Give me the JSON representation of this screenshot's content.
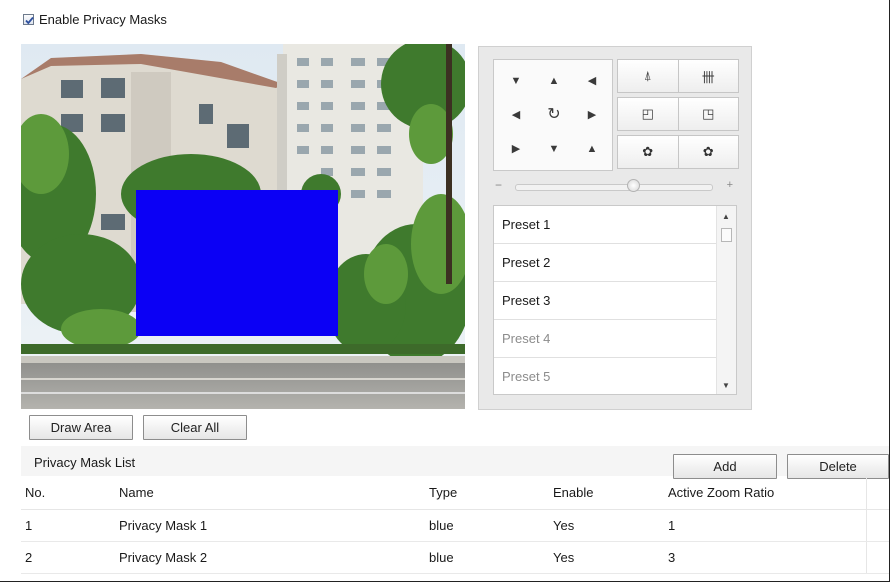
{
  "enable_privacy": {
    "label": "Enable Privacy Masks",
    "checked": true
  },
  "preview": {
    "mask_color": "#0b00f5"
  },
  "ptz": {
    "direction_buttons": [
      {
        "name": "up-left-button",
        "icon": "triangle-down-left-icon",
        "glyph": "▼"
      },
      {
        "name": "up-button",
        "icon": "triangle-up-icon",
        "glyph": "▲"
      },
      {
        "name": "up-right-button",
        "icon": "triangle-down-right-icon",
        "glyph": "◀"
      },
      {
        "name": "left-button",
        "icon": "triangle-left-icon",
        "glyph": "◀"
      },
      {
        "name": "auto-scan-button",
        "icon": "refresh-icon",
        "glyph": "↻"
      },
      {
        "name": "right-button",
        "icon": "triangle-right-icon",
        "glyph": "▶"
      },
      {
        "name": "down-left-button",
        "icon": "triangle-right-icon",
        "glyph": "▶"
      },
      {
        "name": "down-button",
        "icon": "triangle-down-icon",
        "glyph": "▼"
      },
      {
        "name": "down-right-button",
        "icon": "triangle-up-icon",
        "glyph": "▲"
      }
    ],
    "side_buttons": [
      {
        "left_icon": "zoom-in-tree-icon",
        "right_icon": "zoom-out-trees-icon"
      },
      {
        "left_icon": "focus-near-icon",
        "right_icon": "focus-far-icon"
      },
      {
        "left_icon": "iris-open-icon",
        "right_icon": "iris-close-icon"
      }
    ],
    "speed": {
      "minus": "−",
      "plus": "+",
      "level": 0.6
    },
    "presets": [
      {
        "label": "Preset 1",
        "dim": false
      },
      {
        "label": "Preset 2",
        "dim": false
      },
      {
        "label": "Preset 3",
        "dim": false
      },
      {
        "label": "Preset 4",
        "dim": true
      },
      {
        "label": "Preset 5",
        "dim": true
      }
    ]
  },
  "actions": {
    "draw_area": "Draw Area",
    "clear_all": "Clear All",
    "add": "Add",
    "delete": "Delete"
  },
  "mask_list": {
    "title": "Privacy Mask List",
    "columns": [
      "No.",
      "Name",
      "Type",
      "Enable",
      "Active Zoom Ratio",
      ""
    ],
    "rows": [
      [
        "1",
        "Privacy Mask 1",
        "blue",
        "Yes",
        "1",
        ""
      ],
      [
        "2",
        "Privacy Mask 2",
        "blue",
        "Yes",
        "3",
        ""
      ]
    ]
  }
}
